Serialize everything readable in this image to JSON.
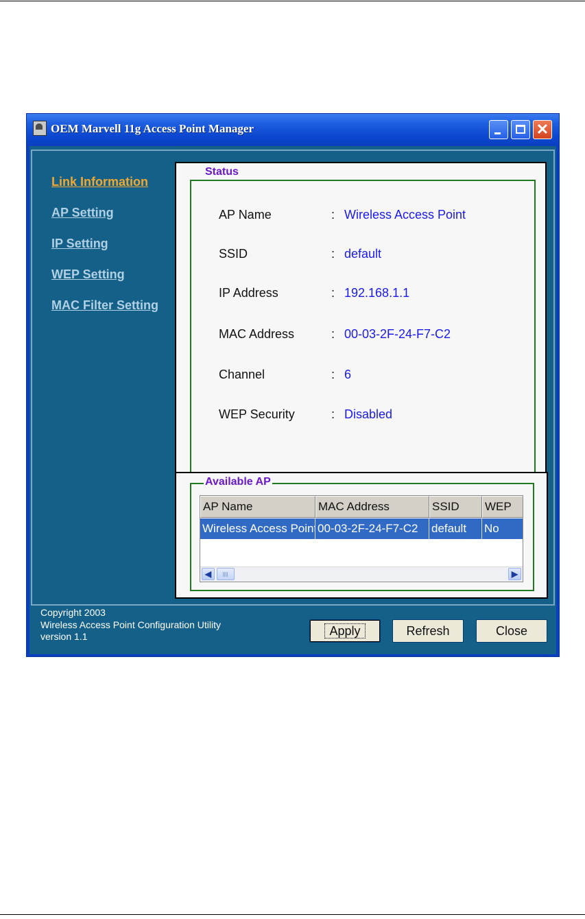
{
  "window": {
    "title": "OEM Marvell 11g Access Point Manager"
  },
  "nav": {
    "items": [
      {
        "label": "Link Information",
        "active": true
      },
      {
        "label": "AP Setting",
        "active": false
      },
      {
        "label": "IP Setting",
        "active": false
      },
      {
        "label": "WEP Setting",
        "active": false
      },
      {
        "label": "MAC Filter Setting",
        "active": false
      }
    ]
  },
  "status": {
    "group_label": "Status",
    "fields": [
      {
        "key": "AP Name",
        "colon": ":",
        "value": "Wireless Access Point"
      },
      {
        "key": "SSID",
        "colon": ":",
        "value": "default"
      },
      {
        "key": "IP Address",
        "colon": ":",
        "value": "192.168.1.1"
      },
      {
        "key": "MAC Address",
        "colon": ":",
        "value": "00-03-2F-24-F7-C2"
      },
      {
        "key": "Channel",
        "colon": ":",
        "value": "6"
      },
      {
        "key": "WEP Security",
        "colon": ":",
        "value": "Disabled"
      }
    ]
  },
  "available_ap": {
    "group_label": "Available AP",
    "columns": [
      "AP Name",
      "MAC Address",
      "SSID",
      "WEP"
    ],
    "rows": [
      [
        "Wireless Access Point",
        "00-03-2F-24-F7-C2",
        "default",
        "No"
      ]
    ]
  },
  "footer": {
    "copyright": "Copyright 2003",
    "utility": "Wireless Access Point Configuration Utility",
    "version": "version 1.1"
  },
  "buttons": {
    "apply": "Apply",
    "refresh": "Refresh",
    "close": "Close"
  },
  "colors": {
    "titlebar": "#0a3fbf",
    "client_bg": "#156088",
    "nav_active": "#f0a830",
    "nav_inactive": "#b0d0e4",
    "group_label": "#6a18c8",
    "group_border": "#1e7a1e",
    "value_text": "#1a1aee",
    "selection": "#316ac5"
  },
  "icons": {
    "app": "app-icon",
    "minimize": "minimize-icon",
    "maximize": "maximize-icon",
    "close": "close-icon",
    "scroll_left": "scroll-left-icon",
    "scroll_right": "scroll-right-icon"
  }
}
